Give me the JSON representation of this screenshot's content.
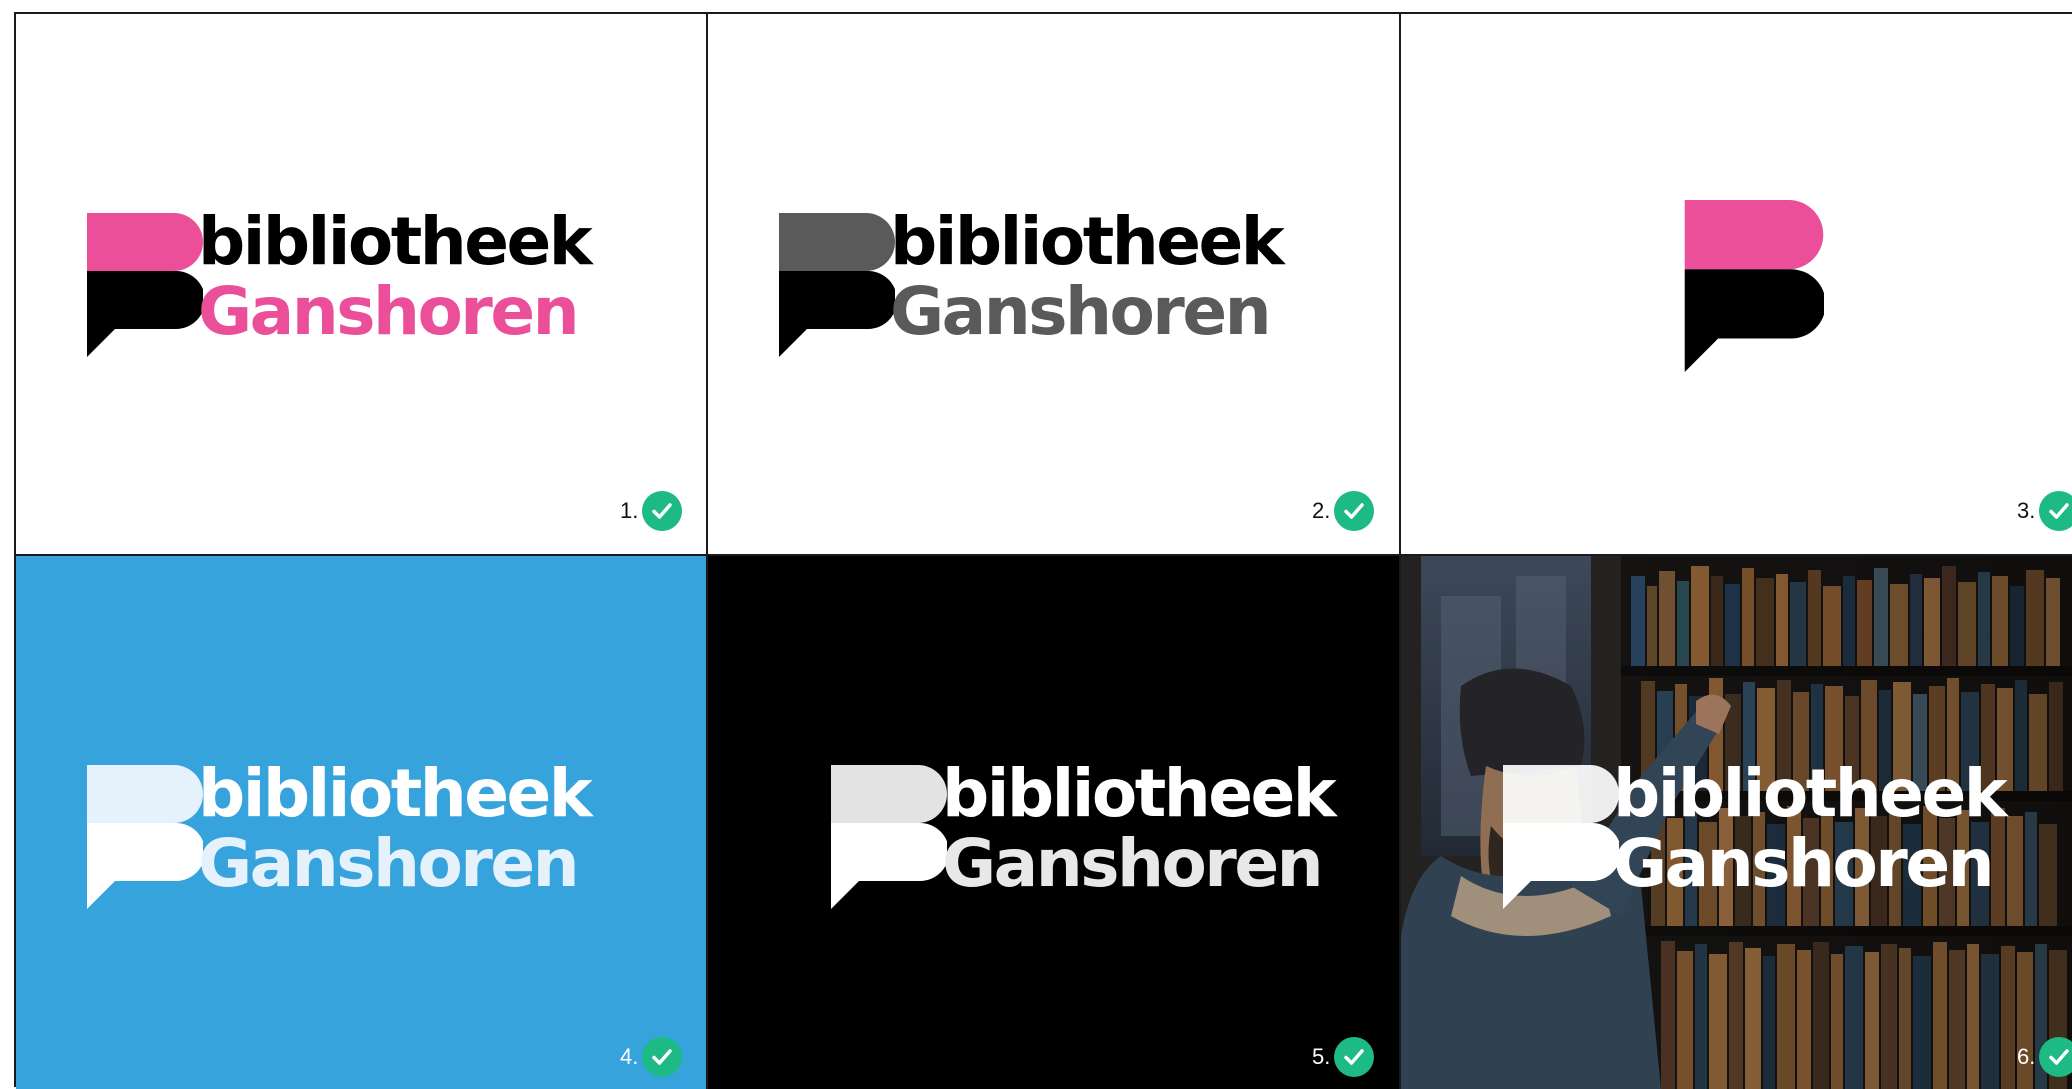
{
  "colors": {
    "brand_pink": "#ec4f9a",
    "brand_black": "#000000",
    "dark_grey": "#5a5a5a",
    "sky_blue": "#37a3dc",
    "light_tint": "#e6f2fb",
    "check_green": "#1dba85"
  },
  "variants": [
    {
      "number": "1.",
      "wordmark_top": "bibliotheek",
      "wordmark_bottom": "Ganshoren",
      "background": "white",
      "top_color": "#ec4f9a",
      "bottom_color": "#000000",
      "icon": "check-circle-icon"
    },
    {
      "number": "2.",
      "wordmark_top": "bibliotheek",
      "wordmark_bottom": "Ganshoren",
      "background": "white",
      "top_color": "#5a5a5a",
      "bottom_color": "#000000",
      "icon": "check-circle-icon"
    },
    {
      "number": "3.",
      "background": "white",
      "top_color": "#ec4f9a",
      "bottom_color": "#000000",
      "icon": "check-circle-icon"
    },
    {
      "number": "4.",
      "wordmark_top": "bibliotheek",
      "wordmark_bottom": "Ganshoren",
      "background": "#37a3dc",
      "top_color": "#e6f2fb",
      "bottom_color": "#ffffff",
      "icon": "check-circle-icon"
    },
    {
      "number": "5.",
      "wordmark_top": "bibliotheek",
      "wordmark_bottom": "Ganshoren",
      "background": "#000000",
      "top_color": "#e3e3e3",
      "bottom_color": "#ffffff",
      "icon": "check-circle-icon"
    },
    {
      "number": "6.",
      "wordmark_top": "bibliotheek",
      "wordmark_bottom": "Ganshoren",
      "background": "photo",
      "top_color": "#ffffff",
      "bottom_color": "#ffffff",
      "icon": "check-circle-icon"
    }
  ]
}
